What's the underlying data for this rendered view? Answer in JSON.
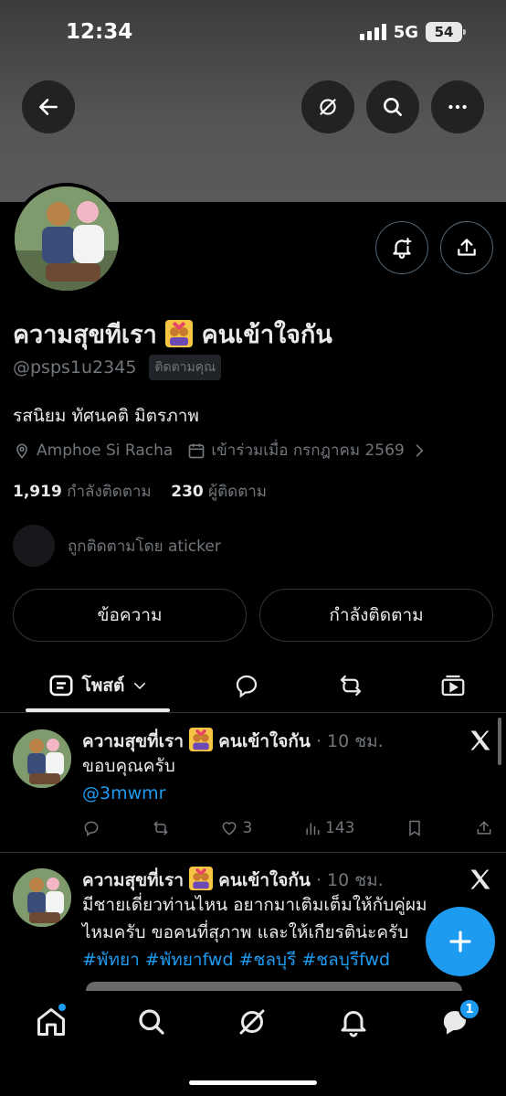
{
  "status_bar": {
    "time": "12:34",
    "network": "5G",
    "battery": "54"
  },
  "header": {
    "back_icon": "arrow-left-icon",
    "grok_icon": "grok-icon",
    "search_icon": "search-icon",
    "more_icon": "more-icon"
  },
  "profile": {
    "display_name": "ความสุขทีเรา",
    "display_name_suffix": "คนเข้าใจกัน",
    "handle": "@psps1u2345",
    "follows_you": "ติดตามคุณ",
    "bio": "รสนิยม ทัศนคติ มิตรภาพ",
    "location": "Amphoe Si Racha",
    "joined": "เข้าร่วมเมื่อ กรกฎาคม 2569",
    "following_count": "1,919",
    "following_label": "กำลังติดตาม",
    "followers_count": "230",
    "followers_label": "ผู้ติดตาม",
    "followed_by": "ถูกติดตามโดย aticker"
  },
  "buttons": {
    "message": "ข้อความ",
    "following": "กำลังติดตาม"
  },
  "tabs": {
    "posts": "โพสต์"
  },
  "posts": [
    {
      "name": "ความสุขที่เรา",
      "name_suffix": "คนเข้าใจกัน",
      "time": "· 10 ชม.",
      "text": "ขอบคุณครับ",
      "mention": "@3mwmr",
      "likes": "3",
      "views": "143"
    },
    {
      "name": "ความสุขที่เรา",
      "name_suffix": "คนเข้าใจกัน",
      "time": "· 10 ชม.",
      "line1": "มีชายเดี่ยวท่านไหน อยากมาเติมเต็มให้กับคู่ผม",
      "line2": "ไหมครับ ขอคนที่สุภาพ และให้เกียรติน่ะครับ",
      "hashtags": "#พัทยา #พัทยาfwd #ชลบุรี #ชลบุรีfwd"
    }
  ],
  "bottom_nav": {
    "messages_badge": "1"
  },
  "colors": {
    "accent": "#1d9bf0",
    "background": "#000000",
    "muted": "#71767b"
  }
}
